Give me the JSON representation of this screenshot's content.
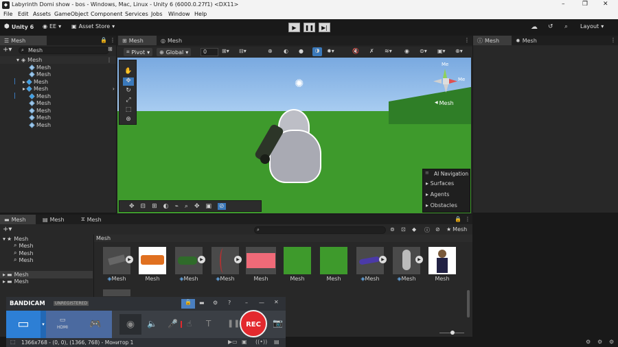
{
  "window": {
    "title": "Labyrinth Domi show - bos - Windows, Mac, Linux - Unity 6 (6000.0.27f1) <DX11>",
    "controls": [
      "–",
      "❐",
      "✕"
    ]
  },
  "menu": [
    "File",
    "Edit",
    "Assets",
    "GameObject",
    "Component",
    "Services",
    "Jobs",
    "Window",
    "Help"
  ],
  "toolbar": {
    "unity_label": "Unity 6",
    "account": "EE",
    "asset_store": "Asset Store",
    "layout": "Layout"
  },
  "hierarchy": {
    "tab": "Mesh",
    "search": "Mesh",
    "root": "Mesh",
    "items": [
      "Mesh",
      "Mesh",
      "Mesh",
      "Mesh",
      "Mesh",
      "Mesh",
      "Mesh",
      "Mesh",
      "Mesh"
    ]
  },
  "scene": {
    "tab_scene": "Mesh",
    "tab_game": "Mesh",
    "pivot": "Pivot",
    "global": "Global",
    "snap_value": "0",
    "gizmo_label": "Me",
    "gizmo_label2": "Me",
    "camera_label": "Mesh",
    "overlay": {
      "title": "AI Navigation",
      "items": [
        "Surfaces",
        "Agents",
        "Obstacles"
      ]
    }
  },
  "inspector": {
    "tab1": "Mesh",
    "tab2": "Mesh"
  },
  "project": {
    "tabs": [
      "Mesh",
      "Mesh",
      "Mesh"
    ],
    "favorites": "Mesh",
    "fav_items": [
      "Mesh",
      "Mesh",
      "Mesh"
    ],
    "folders": [
      "Mesh",
      "Mesh"
    ],
    "breadcrumb": "Mesh",
    "filter_label": "Mesh",
    "assets": [
      "Mesh",
      "Mesh",
      "Mesh",
      "Mesh",
      "Mesh",
      "Mesh",
      "Mesh",
      "Mesh",
      "Mesh",
      "Mesh"
    ]
  },
  "bandicam": {
    "brand": "BANDICAM",
    "badge": "UNREGISTERED",
    "rec": "REC",
    "hdmi": "HDMI",
    "status": "1366x768 - (0, 0), (1366, 768) - Монитор 1"
  },
  "colors": {
    "accent": "#3a79bb",
    "rec": "#e3292e",
    "grass": "#3e9a2c"
  }
}
